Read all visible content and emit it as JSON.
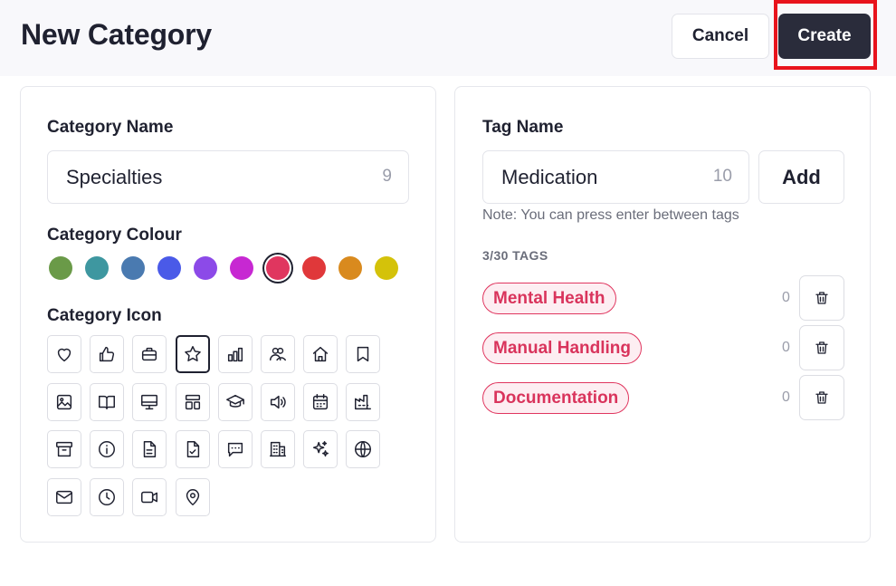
{
  "header": {
    "title": "New Category",
    "cancel_label": "Cancel",
    "create_label": "Create"
  },
  "category": {
    "name_label": "Category Name",
    "name_value": "Specialties",
    "name_count": "9",
    "colour_label": "Category Colour",
    "colours": [
      "#6a9a48",
      "#3e97a0",
      "#4a7ab0",
      "#4a5ae8",
      "#8c4ae8",
      "#c728d2",
      "#e0365f",
      "#e0383a",
      "#d98a1e",
      "#d4c20a"
    ],
    "selected_colour": "#e0365f",
    "icon_label": "Category Icon",
    "icons": [
      "heart-icon",
      "thumbs-up-icon",
      "briefcase-icon",
      "star-icon",
      "bar-chart-icon",
      "users-icon",
      "home-icon",
      "bookmark-icon",
      "image-icon",
      "book-open-icon",
      "monitor-icon",
      "layout-icon",
      "graduation-cap-icon",
      "speaker-icon",
      "calendar-icon",
      "factory-icon",
      "archive-icon",
      "info-icon",
      "file-text-icon",
      "file-check-icon",
      "message-icon",
      "building-icon",
      "sparkles-icon",
      "globe-icon",
      "mail-icon",
      "clock-icon",
      "video-icon",
      "map-pin-icon"
    ],
    "selected_icon": "star-icon"
  },
  "tags": {
    "name_label": "Tag Name",
    "name_value": "Medication",
    "name_count": "10",
    "add_label": "Add",
    "note": "Note: You can press enter between tags",
    "count_label": "3/30 TAGS",
    "items": [
      {
        "label": "Mental Health",
        "count": "0"
      },
      {
        "label": "Manual Handling",
        "count": "0"
      },
      {
        "label": "Documentation",
        "count": "0"
      }
    ],
    "delete_icon": "trash-icon"
  },
  "colors": {
    "primary_button": "#2a2c3b",
    "highlight_box": "#e8131c",
    "tag_accent": "#d9345c"
  }
}
